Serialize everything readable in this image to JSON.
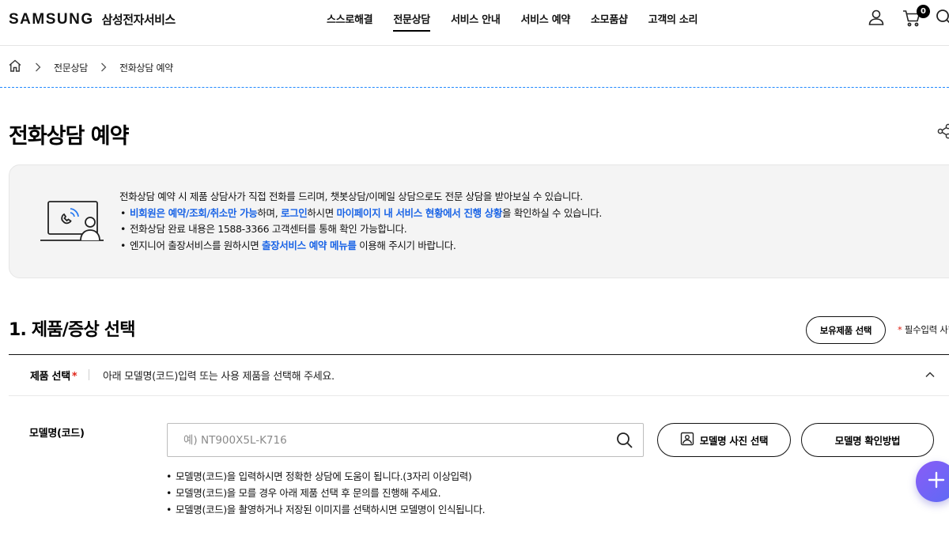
{
  "header": {
    "logo_word": "SAMSUNG",
    "logo_sub": "삼성전자서비스",
    "nav": [
      {
        "label": "스스로해결",
        "active": false
      },
      {
        "label": "전문상담",
        "active": true
      },
      {
        "label": "서비스 안내",
        "active": false
      },
      {
        "label": "서비스 예약",
        "active": false
      },
      {
        "label": "소모품샵",
        "active": false
      },
      {
        "label": "고객의 소리",
        "active": false
      }
    ],
    "cart_count": "0",
    "icons": [
      "user-icon",
      "cart-icon",
      "search-icon"
    ]
  },
  "breadcrumb": {
    "items": [
      "전문상담",
      "전화상담 예약"
    ],
    "home_icon": "home-icon"
  },
  "page_title": "전화상담 예약",
  "info": {
    "intro": "전화상담 예약 시 제품 상담사가 직접 전화를 드리며, 챗봇상담/이메일 상담으로도 전문 상담을 받아보실 수 있습니다.",
    "bullet1": {
      "hl1": "비회원은 예약/조회/취소만 가능",
      "t1": "하며, ",
      "hl2": "로그인",
      "t2": "하시면 ",
      "hl3": "마이페이지 내 서비스 현황에서 진행 상황",
      "t3": "을 확인하실 수 있습니다."
    },
    "bullet2": "전화상담 완료 내용은 1588-3366 고객센터를 통해 확인 가능합니다.",
    "bullet3": {
      "t1": "엔지니어 출장서비스를 원하시면 ",
      "hl1": "출장서비스 예약 메뉴를",
      "t2": " 이용해 주시기 바랍니다."
    }
  },
  "section1": {
    "title": "1. 제품/증상 선택",
    "own_product_button": "보유제품 선택",
    "required_star": "*",
    "required_note": " 필수입력 사항",
    "product_label": "제품 선택",
    "product_desc": "아래 모델명(코드)입력 또는 사용 제품을 선택해 주세요.",
    "model_label": "모델명(코드)",
    "model_placeholder": "예) NT900X5L-K716",
    "model_value": "",
    "photo_button": "모델명 사진 선택",
    "howto_button": "모델명 확인방법",
    "notes": [
      "모델명(코드)을 입력하시면 정확한 상담에 도움이 됩니다.(3자리 이상입력)",
      "모델명(코드)을 모를 경우 아래 제품 선택 후 문의를 진행해 주세요.",
      "모델명(코드)을 촬영하거나 저장된 이미지를 선택하시면 모델명이 인식됩니다."
    ]
  },
  "colors": {
    "highlight": "#1a64e6",
    "required": "#e0261a",
    "fab": "#7a62f5",
    "divider_dashed": "#2189ff"
  }
}
